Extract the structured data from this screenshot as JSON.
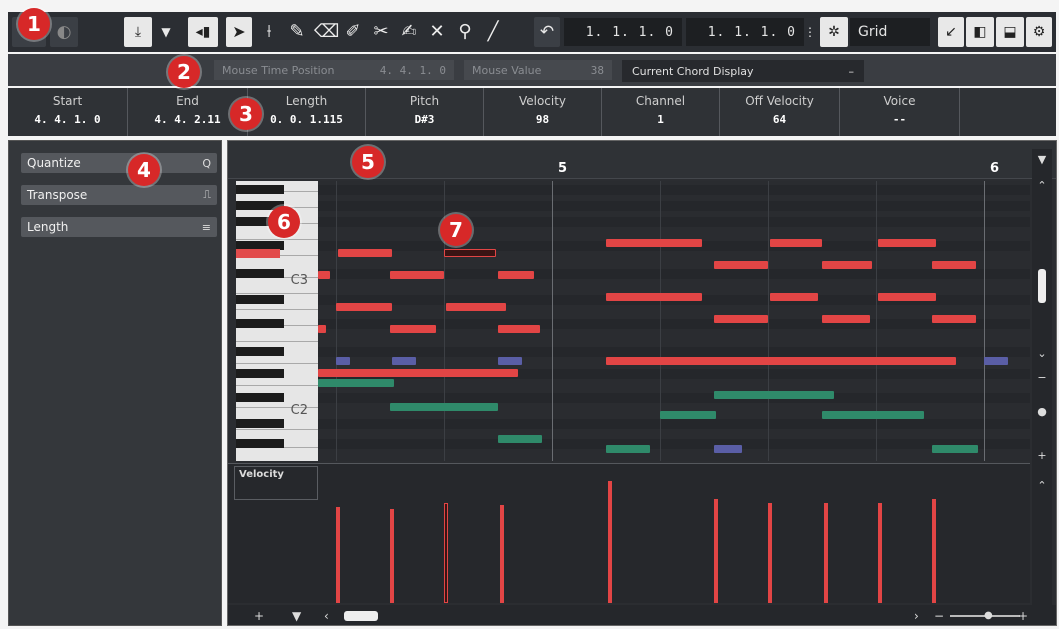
{
  "toolbar": {
    "pos_left": "1. 1. 1.  0",
    "pos_right": "1. 1. 1.  0",
    "grid_label": "Grid",
    "icons": [
      "record-button",
      "play-toggle",
      "snap-icon",
      "dropdown-icon",
      "speaker-icon",
      "pointer-tool",
      "range-tool",
      "pencil-tool",
      "eraser-tool",
      "draw-tool",
      "scissors-tool",
      "glue-tool",
      "mute-tool",
      "zoom-tool",
      "line-tool",
      "undo-icon",
      "grid-icon",
      "arrow-icon",
      "left-panel-icon",
      "bottom-panel-icon",
      "settings-icon"
    ]
  },
  "status_line": {
    "mouse_time_label": "Mouse Time Position",
    "mouse_time_value": "4. 4. 1.  0",
    "mouse_value_label": "Mouse Value",
    "mouse_value_value": "38",
    "chord_label": "Current Chord Display",
    "chord_value": "–"
  },
  "info_line": [
    {
      "label": "Start",
      "value": "4. 4. 1.  0"
    },
    {
      "label": "End",
      "value": "4. 4. 2.11"
    },
    {
      "label": "Length",
      "value": "0. 0. 1.115"
    },
    {
      "label": "Pitch",
      "value": "D#3"
    },
    {
      "label": "Velocity",
      "value": "98"
    },
    {
      "label": "Channel",
      "value": "1"
    },
    {
      "label": "Off Velocity",
      "value": "64"
    },
    {
      "label": "Voice",
      "value": "--"
    }
  ],
  "left_zone": {
    "sections": [
      {
        "label": "Quantize",
        "icon": "Q"
      },
      {
        "label": "Transpose",
        "icon": "⎍"
      },
      {
        "label": "Length",
        "icon": "≡"
      }
    ]
  },
  "ruler": {
    "bar5": "5",
    "bar6": "6"
  },
  "keyboard": {
    "c3": "C3",
    "c2": "C2"
  },
  "velocity_lane": {
    "label": "Velocity"
  },
  "callouts": [
    "1",
    "2",
    "3",
    "4",
    "5",
    "6",
    "7"
  ],
  "colors": {
    "note_red": "#e24545",
    "note_green": "#2f8a6a",
    "note_blue": "#5a5ea6",
    "record_red": "#d72828"
  }
}
